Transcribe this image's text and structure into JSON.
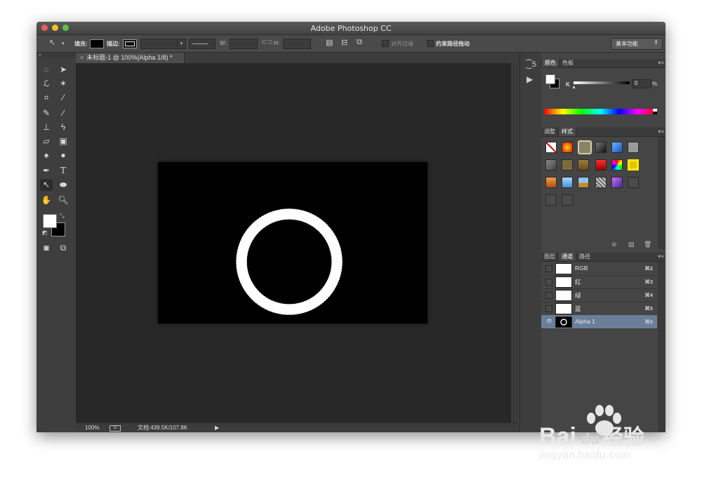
{
  "app": {
    "title": "Adobe Photoshop CC",
    "traffic_colors": [
      "#ec5f57",
      "#f3bd2f",
      "#5ec443"
    ]
  },
  "options_bar": {
    "fill_label": "填充:",
    "stroke_label": "描边:",
    "w_label": "W:",
    "h_label": "H:",
    "align_edges_label": "对齐边缘",
    "constrain_path_label": "约束路径拖动",
    "workspace": "基本功能"
  },
  "document": {
    "tab_label": "未标题-1 @ 100%(Alpha 1/8) *",
    "close_glyph": "×",
    "zoom": "100%",
    "doc_size": "文档:439.5K/107.8K"
  },
  "color_panel": {
    "tabs": [
      "颜色",
      "色板"
    ],
    "k_label": "K",
    "k_value": "0",
    "percent": "%"
  },
  "styles_panel": {
    "tabs": [
      "调整",
      "样式"
    ]
  },
  "channels_panel": {
    "tabs": [
      "图层",
      "通道",
      "路径"
    ],
    "rows": [
      {
        "name": "RGB",
        "shortcut": "⌘2"
      },
      {
        "name": "红",
        "shortcut": "⌘3"
      },
      {
        "name": "绿",
        "shortcut": "⌘4"
      },
      {
        "name": "蓝",
        "shortcut": "⌘5"
      },
      {
        "name": "Alpha 1",
        "shortcut": "⌘6"
      }
    ]
  },
  "watermark": {
    "brand": "Bai",
    "brand_tail": "du",
    "product": "经验",
    "url": "jingyan.baidu.com"
  }
}
